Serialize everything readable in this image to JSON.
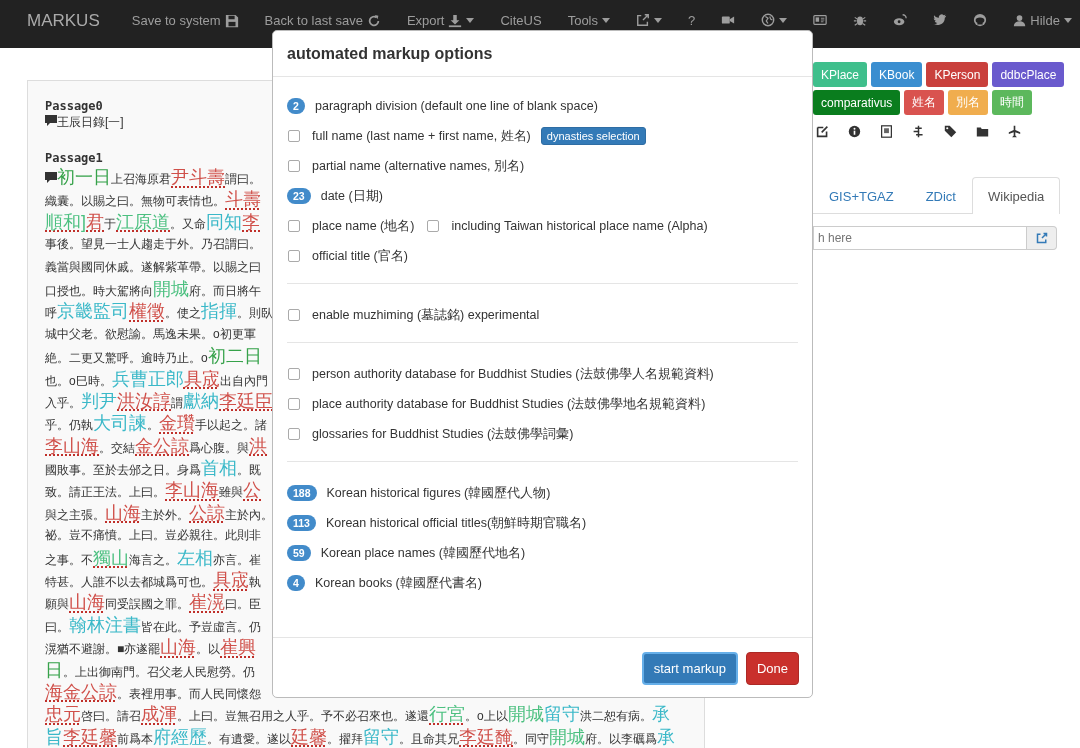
{
  "navbar": {
    "brand": "MARKUS",
    "items": [
      {
        "kind": "save",
        "label": "Save to system",
        "dropdown": false
      },
      {
        "kind": "reload",
        "label": "Back to last save",
        "dropdown": false
      },
      {
        "kind": "export",
        "label": "Export",
        "dropdown": true
      },
      {
        "kind": "text",
        "label": "CiteUS",
        "dropdown": false
      },
      {
        "kind": "text",
        "label": "Tools",
        "dropdown": true
      },
      {
        "kind": "external",
        "dropdown": true
      },
      {
        "kind": "text",
        "label": "?",
        "dropdown": false
      },
      {
        "kind": "video",
        "dropdown": false
      },
      {
        "kind": "globe",
        "dropdown": true
      },
      {
        "kind": "idcard",
        "dropdown": false
      },
      {
        "kind": "bug",
        "dropdown": false
      },
      {
        "kind": "weibo",
        "dropdown": false
      },
      {
        "kind": "twitter",
        "dropdown": false
      },
      {
        "kind": "github",
        "dropdown": false
      },
      {
        "kind": "user",
        "label": "Hilde",
        "dropdown": true
      }
    ]
  },
  "text_panel": {
    "passages": [
      {
        "title": "Passage0",
        "lines": [
          {
            "comment": true,
            "segments": [
              {
                "kind": "plain",
                "text": "王辰日錄[一]"
              }
            ]
          }
        ]
      },
      {
        "title": "Passage1",
        "lines": [
          {
            "comment": true,
            "segments": [
              {
                "kind": "time",
                "text": "初一日"
              },
              {
                "kind": "plain",
                "text": "上召海原君"
              },
              {
                "kind": "person",
                "text": "尹斗壽"
              },
              {
                "kind": "plain",
                "text": "謂曰。"
              }
            ]
          },
          {
            "comment": false,
            "segments": [
              {
                "kind": "plain",
                "text": "織囊。以賜之曰。無物可表情也。"
              },
              {
                "kind": "person",
                "text": "斗壽"
              }
            ]
          },
          {
            "comment": false,
            "segments": [
              {
                "kind": "place",
                "text": "順和]"
              },
              {
                "kind": "person",
                "text": "君"
              },
              {
                "kind": "plain",
                "text": "于"
              },
              {
                "kind": "place",
                "text": "江原道"
              },
              {
                "kind": "plain",
                "text": "。又命"
              },
              {
                "kind": "office",
                "text": "同知"
              },
              {
                "kind": "person",
                "text": "李"
              }
            ]
          },
          {
            "comment": false,
            "segments": [
              {
                "kind": "plain",
                "text": "事後。望見一士人趨走于外。乃召謂曰。"
              }
            ]
          },
          {
            "comment": false,
            "segments": [
              {
                "kind": "plain",
                "text": "義當與國同休戚。遂解紫革帶。以賜之曰"
              }
            ]
          },
          {
            "comment": false,
            "segments": [
              {
                "kind": "plain",
                "text": "口授也。時大駕將向"
              },
              {
                "kind": "city",
                "text": "開城"
              },
              {
                "kind": "plain",
                "text": "府。而日將午"
              }
            ]
          },
          {
            "comment": false,
            "segments": [
              {
                "kind": "plain",
                "text": "呼"
              },
              {
                "kind": "office",
                "text": "京畿監司"
              },
              {
                "kind": "person",
                "text": "權徵"
              },
              {
                "kind": "plain",
                "text": "。使之"
              },
              {
                "kind": "office",
                "text": "指揮"
              },
              {
                "kind": "plain",
                "text": "。則臥"
              }
            ]
          },
          {
            "comment": false,
            "segments": [
              {
                "kind": "plain",
                "text": "城中父老。欲慰諭。馬逸未果。o初更軍"
              }
            ]
          },
          {
            "comment": false,
            "segments": [
              {
                "kind": "plain",
                "text": "絶。二更又驚呼。逾時乃止。o"
              },
              {
                "kind": "time",
                "text": "初二日"
              }
            ]
          },
          {
            "comment": false,
            "segments": [
              {
                "kind": "plain",
                "text": "也。o巳時。"
              },
              {
                "kind": "office",
                "text": "兵曹正郎"
              },
              {
                "kind": "person",
                "text": "具宬"
              },
              {
                "kind": "plain",
                "text": "出自內門"
              }
            ]
          },
          {
            "comment": false,
            "segments": [
              {
                "kind": "plain",
                "text": "入乎。"
              },
              {
                "kind": "office",
                "text": "判尹"
              },
              {
                "kind": "person",
                "text": "洪汝諄"
              },
              {
                "kind": "plain",
                "text": "謂"
              },
              {
                "kind": "office",
                "text": "獻納"
              },
              {
                "kind": "person",
                "text": "李廷臣"
              }
            ]
          },
          {
            "comment": false,
            "segments": [
              {
                "kind": "plain",
                "text": "乎。仍執"
              },
              {
                "kind": "office",
                "text": "大司諫"
              },
              {
                "kind": "plain",
                "text": "。"
              },
              {
                "kind": "person",
                "text": "金瓚"
              },
              {
                "kind": "plain",
                "text": "手以起之。諸"
              }
            ]
          },
          {
            "comment": false,
            "segments": [
              {
                "kind": "person",
                "text": "李山海"
              },
              {
                "kind": "plain",
                "text": "。交結"
              },
              {
                "kind": "person",
                "text": "金公諒"
              },
              {
                "kind": "plain",
                "text": "爲心腹。與"
              },
              {
                "kind": "person",
                "text": "洪"
              }
            ]
          },
          {
            "comment": false,
            "segments": [
              {
                "kind": "plain",
                "text": "國敗事。至於去邠之日。身爲"
              },
              {
                "kind": "office",
                "text": "首相"
              },
              {
                "kind": "plain",
                "text": "。既"
              }
            ]
          },
          {
            "comment": false,
            "segments": [
              {
                "kind": "plain",
                "text": "致。請正王法。上曰。"
              },
              {
                "kind": "person",
                "text": "李山海"
              },
              {
                "kind": "plain",
                "text": "雖與"
              },
              {
                "kind": "person",
                "text": "公"
              }
            ]
          },
          {
            "comment": false,
            "segments": [
              {
                "kind": "plain",
                "text": "與之主張。"
              },
              {
                "kind": "person",
                "text": "山海"
              },
              {
                "kind": "plain",
                "text": "主於外。"
              },
              {
                "kind": "person",
                "text": "公諒"
              },
              {
                "kind": "plain",
                "text": "主於內。"
              }
            ]
          },
          {
            "comment": false,
            "segments": [
              {
                "kind": "plain",
                "text": "祕。豈不痛憤。上曰。豈必親往。此則非"
              }
            ]
          },
          {
            "comment": false,
            "segments": [
              {
                "kind": "plain",
                "text": "之事。不"
              },
              {
                "kind": "place",
                "text": "獨山"
              },
              {
                "kind": "plain",
                "text": "海言之。"
              },
              {
                "kind": "office",
                "text": "左相"
              },
              {
                "kind": "plain",
                "text": "亦言。崔"
              }
            ]
          },
          {
            "comment": false,
            "segments": [
              {
                "kind": "plain",
                "text": "特甚。人誰不以去都城爲可也。"
              },
              {
                "kind": "person",
                "text": "具宬"
              },
              {
                "kind": "plain",
                "text": "執"
              }
            ]
          },
          {
            "comment": false,
            "segments": [
              {
                "kind": "plain",
                "text": "願與"
              },
              {
                "kind": "person",
                "text": "山海"
              },
              {
                "kind": "plain",
                "text": "同受誤國之罪。"
              },
              {
                "kind": "person",
                "text": "崔滉"
              },
              {
                "kind": "plain",
                "text": "曰。臣"
              }
            ]
          },
          {
            "comment": false,
            "segments": [
              {
                "kind": "plain",
                "text": "曰。"
              },
              {
                "kind": "office",
                "text": "翰林注書"
              },
              {
                "kind": "plain",
                "text": "皆在此。予豈虛言。仍"
              }
            ]
          },
          {
            "comment": false,
            "segments": [
              {
                "kind": "plain",
                "text": "滉猶不避謝。■亦遂罷"
              },
              {
                "kind": "person",
                "text": "山海"
              },
              {
                "kind": "plain",
                "text": "。以"
              },
              {
                "kind": "person",
                "text": "崔興"
              }
            ]
          },
          {
            "comment": false,
            "segments": [
              {
                "kind": "time",
                "text": "日"
              },
              {
                "kind": "plain",
                "text": "。上出御南門。召父老人民慰勞。仍"
              }
            ]
          },
          {
            "comment": false,
            "segments": [
              {
                "kind": "person",
                "text": "海金公諒"
              },
              {
                "kind": "plain",
                "text": "。表裡用事。而人民同懷怨"
              }
            ]
          },
          {
            "comment": false,
            "segments": [
              {
                "kind": "person",
                "text": "忠元"
              },
              {
                "kind": "plain",
                "text": "啓曰。請召"
              },
              {
                "kind": "person",
                "text": "成渾"
              },
              {
                "kind": "plain",
                "text": "。上曰。豈無召用之人乎。予不必召來也。遂還"
              },
              {
                "kind": "place",
                "text": "行宮"
              },
              {
                "kind": "plain",
                "text": "。o上以"
              },
              {
                "kind": "city",
                "text": "開城"
              },
              {
                "kind": "office",
                "text": "留守"
              },
              {
                "kind": "plain",
                "text": "洪二恕有病。"
              },
              {
                "kind": "office",
                "text": "承"
              }
            ]
          },
          {
            "comment": false,
            "segments": [
              {
                "kind": "office",
                "text": "旨"
              },
              {
                "kind": "person",
                "text": "李廷馨"
              },
              {
                "kind": "plain",
                "text": "前爲本"
              },
              {
                "kind": "office",
                "text": "府經歷"
              },
              {
                "kind": "plain",
                "text": "。有遺愛。遂以"
              },
              {
                "kind": "person",
                "text": "廷馨"
              },
              {
                "kind": "plain",
                "text": "。擢拜"
              },
              {
                "kind": "office",
                "text": "留守"
              },
              {
                "kind": "plain",
                "text": "。且命其兄"
              },
              {
                "kind": "person",
                "text": "李廷馣"
              },
              {
                "kind": "plain",
                "text": "。同守"
              },
              {
                "kind": "city",
                "text": "開城"
              },
              {
                "kind": "plain",
                "text": "府。以李礪爲"
              },
              {
                "kind": "office",
                "text": "承"
              }
            ]
          }
        ]
      }
    ]
  },
  "right_panel": {
    "tag_rows": [
      [
        {
          "label": "KPlace",
          "color": "#3fbf8c"
        },
        {
          "label": "KBook",
          "color": "#3a8ed0"
        },
        {
          "label": "KPerson",
          "color": "#c9403c"
        },
        {
          "label": "ddbcPlace",
          "color": "#6a5acd"
        }
      ],
      [
        {
          "label": "comparativus",
          "color": "#0a7d1e"
        },
        {
          "label": "姓名",
          "color": "#d9534f"
        },
        {
          "label": "別名",
          "color": "#f0ad4e"
        },
        {
          "label": "時間",
          "color": "#5cb85c"
        }
      ]
    ],
    "tools": [
      {
        "kind": "edit"
      },
      {
        "kind": "info"
      },
      {
        "kind": "card"
      },
      {
        "kind": "tree"
      },
      {
        "kind": "tags"
      },
      {
        "kind": "folder"
      },
      {
        "kind": "plane"
      }
    ],
    "tabs": [
      {
        "label": "GIS+TGAZ",
        "selected": false
      },
      {
        "label": "ZDict",
        "selected": false
      },
      {
        "label": "Wikipedia",
        "selected": true
      }
    ],
    "search": {
      "placeholder": "h here"
    }
  },
  "modal": {
    "title": "automated markup options",
    "sections": [
      [
        {
          "kind": "count",
          "count": "2",
          "label": "paragraph division (default one line of blank space)"
        },
        {
          "kind": "checkbox",
          "checked": false,
          "label": "full name (last name + first name, 姓名)",
          "action": "dynasties selection"
        },
        {
          "kind": "checkbox",
          "checked": false,
          "label": "partial name (alternative names, 別名)"
        },
        {
          "kind": "count",
          "count": "23",
          "label": "date (日期)"
        },
        {
          "kind": "checkbox",
          "checked": false,
          "label": "place name (地名)",
          "option": {
            "checked": false,
            "label": "including Taiwan historical place name (Alpha)"
          }
        },
        {
          "kind": "checkbox",
          "checked": false,
          "label": "official title (官名)"
        }
      ],
      [
        {
          "kind": "checkbox",
          "checked": false,
          "label": "enable muzhiming (墓誌銘) experimental"
        }
      ],
      [
        {
          "kind": "checkbox",
          "checked": false,
          "label": "person authority database for Buddhist Studies (法鼓佛學人名規範資料)"
        },
        {
          "kind": "checkbox",
          "checked": false,
          "label": "place authority database for Buddhist Studies (法鼓佛學地名規範資料)"
        },
        {
          "kind": "checkbox",
          "checked": false,
          "label": "glossaries for Buddhist Studies (法鼓佛學詞彙)"
        }
      ],
      [
        {
          "kind": "count",
          "count": "188",
          "label": "Korean historical figures (韓國歷代人物)"
        },
        {
          "kind": "count",
          "count": "113",
          "label": "Korean historical official titles(朝鮮時期官職名)"
        },
        {
          "kind": "count",
          "count": "59",
          "label": "Korean place names (韓國歷代地名)"
        },
        {
          "kind": "count",
          "count": "4",
          "label": "Korean books (韓國歷代書名)"
        }
      ]
    ],
    "buttons": [
      {
        "kind": "primary",
        "label": "start markup"
      },
      {
        "kind": "danger",
        "label": "Done"
      }
    ]
  }
}
